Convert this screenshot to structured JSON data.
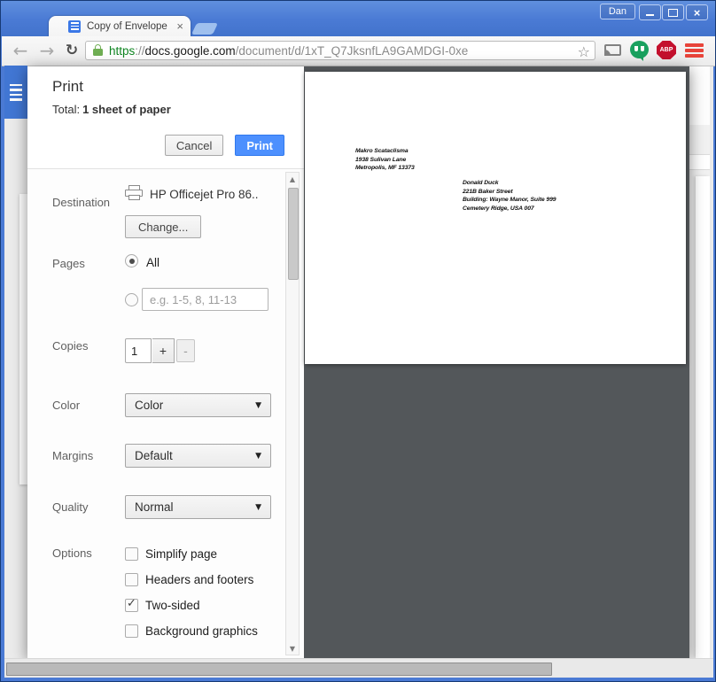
{
  "titlebar": {
    "user_label": "Dan",
    "tab_title": "Copy of Envelope Size"
  },
  "icons": {
    "tab_close": "×",
    "window_close": "×",
    "back": "←",
    "forward": "→",
    "refresh": "↻",
    "bookmark_star": "☆",
    "abp_label": "ABP",
    "dropdown_arrow": "▼",
    "scroll_up": "▲",
    "scroll_down": "▼",
    "check": "✓"
  },
  "url": {
    "scheme": "https",
    "separator": "://",
    "host": "docs.google.com",
    "path": "/document/d/1xT_Q7JksnfLA9GAMDGI-0xe"
  },
  "dialog": {
    "title": "Print",
    "total_prefix": "Total:",
    "total_value": "1 sheet of paper",
    "cancel_label": "Cancel",
    "print_label": "Print",
    "destination": {
      "label": "Destination",
      "printer_name": "HP Officejet Pro 86..",
      "change_label": "Change..."
    },
    "pages": {
      "label": "Pages",
      "all_label": "All",
      "all_selected": true,
      "range_placeholder": "e.g. 1-5, 8, 11-13"
    },
    "copies": {
      "label": "Copies",
      "value": "1",
      "increment_label": "+",
      "decrement_label": "-"
    },
    "color": {
      "label": "Color",
      "value": "Color"
    },
    "margins": {
      "label": "Margins",
      "value": "Default"
    },
    "quality": {
      "label": "Quality",
      "value": "Normal"
    },
    "options": {
      "label": "Options",
      "items": [
        {
          "label": "Simplify page",
          "checked": false
        },
        {
          "label": "Headers and footers",
          "checked": false
        },
        {
          "label": "Two-sided",
          "checked": true
        },
        {
          "label": "Background graphics",
          "checked": false
        }
      ]
    }
  },
  "preview": {
    "return_address": [
      "Makro Scataclisma",
      "1938 Sulivan Lane",
      "Metropolis, MF 13373"
    ],
    "recipient_address": [
      "Donald Duck",
      "221B Baker Street",
      "Building: Wayne Manor, Suite 999",
      "Cemetery Ridge, USA 007"
    ]
  },
  "colors": {
    "titlebar_blue": "#4a7ad4",
    "accent_blue": "#4d90fe",
    "preview_background": "#53575a",
    "https_green": "#0e8420",
    "abp_red": "#c4112e",
    "menu_red": "#e8443a"
  }
}
